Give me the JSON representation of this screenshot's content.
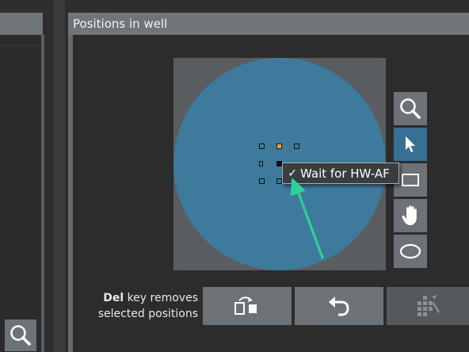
{
  "panel": {
    "title": "Positions in well"
  },
  "context_menu": {
    "checkmark": "✓",
    "item_label": "Wait for HW-AF",
    "item_checked": true
  },
  "footer": {
    "del_key": "Del",
    "hint_rest_line1": " key removes",
    "hint_line2": "selected positions"
  },
  "tools": [
    {
      "name": "zoom",
      "icon": "magnifier-icon",
      "active": false
    },
    {
      "name": "select",
      "icon": "cursor-arrow-icon",
      "active": true
    },
    {
      "name": "rectangle",
      "icon": "rectangle-icon",
      "active": false
    },
    {
      "name": "pan",
      "icon": "hand-icon",
      "active": false
    },
    {
      "name": "ellipse",
      "icon": "ellipse-icon",
      "active": false
    }
  ],
  "bottom_buttons": [
    {
      "name": "move-positions",
      "icon": "rotate-positions-icon",
      "enabled": true
    },
    {
      "name": "undo",
      "icon": "undo-arrow-icon",
      "enabled": true
    },
    {
      "name": "grid-fill",
      "icon": "grid-wand-icon",
      "enabled": false
    }
  ],
  "colors": {
    "well": "#3d7a9b",
    "selected_position": "#e8a23c",
    "annotation_arrow": "#2fd19a",
    "active_tool": "#3a6f95"
  }
}
